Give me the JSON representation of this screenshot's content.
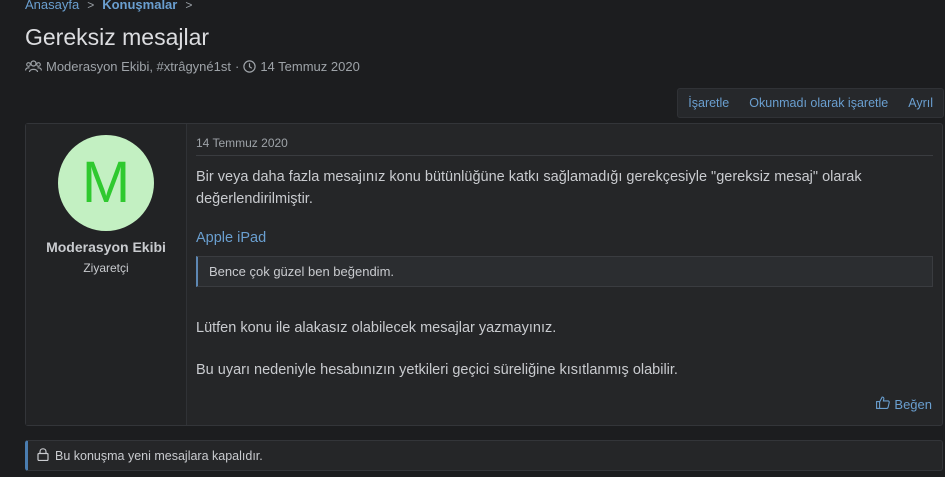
{
  "breadcrumb": {
    "items": [
      "Anasayfa",
      "Konuşmalar"
    ]
  },
  "thread": {
    "title": "Gereksiz mesajlar",
    "participants": "Moderasyon Ekibi, #xtrâgyné1st",
    "separator": "·",
    "date": "14 Temmuz 2020"
  },
  "toolbar": {
    "mark_label": "İşaretle",
    "mark_unread_label": "Okunmadı olarak işaretle",
    "leave_label": "Ayrıl"
  },
  "message": {
    "avatar_letter": "M",
    "username": "Moderasyon Ekibi",
    "user_title": "Ziyaretçi",
    "date": "14 Temmuz 2020",
    "paragraph1": "Bir veya daha fazla mesajınız konu bütünlüğüne katkı sağlamadığı gerekçesiyle \"gereksiz mesaj\" olarak değerlendirilmiştir.",
    "quote_title": "Apple iPad",
    "quote_text": "Bence çok güzel ben beğendim.",
    "paragraph2": "Lütfen konu ile alakasız olabilecek mesajlar yazmayınız.",
    "paragraph3": "Bu uyarı nedeniyle hesabınızın yetkileri geçici süreliğine kısıtlanmış olabilir.",
    "like_label": "Beğen"
  },
  "notice": {
    "text": "Bu konuşma yeni mesajlara kapalıdır."
  },
  "colors": {
    "background": "#1c1d1f",
    "link": "#6a9fd0",
    "avatar_bg": "#c3f0c2",
    "avatar_fg": "#2fc92f"
  },
  "icons": {
    "participants": "users-icon",
    "date": "clock-icon",
    "like": "thumbs-up-icon",
    "locked": "lock-icon"
  }
}
